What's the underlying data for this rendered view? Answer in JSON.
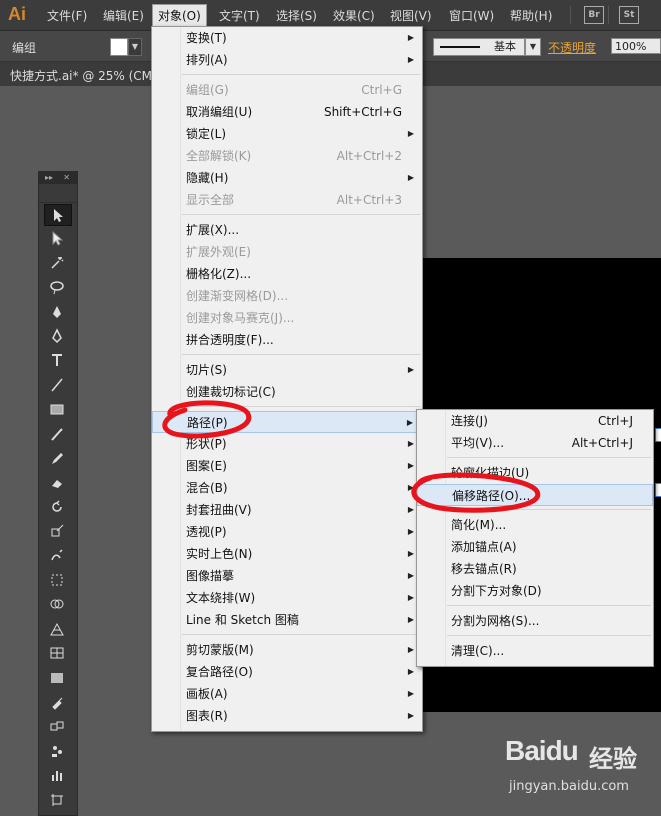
{
  "app": {
    "logo": "Ai"
  },
  "menubar": {
    "items": [
      "文件(F)",
      "编辑(E)",
      "对象(O)",
      "文字(T)",
      "选择(S)",
      "效果(C)",
      "视图(V)",
      "窗口(W)",
      "帮助(H)"
    ],
    "badges": [
      "Br",
      "St"
    ]
  },
  "control": {
    "label": "编组",
    "stroke_style": "基本",
    "opacity_label": "不透明度",
    "opacity_value": "100%"
  },
  "document": {
    "tab_label": "快捷方式.ai* @ 25% (CM"
  },
  "object_menu": [
    {
      "label": "变换(T)",
      "submenu": true
    },
    {
      "label": "排列(A)",
      "submenu": true
    },
    {
      "sep": true
    },
    {
      "label": "编组(G)",
      "shortcut": "Ctrl+G",
      "disabled": true
    },
    {
      "label": "取消编组(U)",
      "shortcut": "Shift+Ctrl+G"
    },
    {
      "label": "锁定(L)",
      "submenu": true
    },
    {
      "label": "全部解锁(K)",
      "shortcut": "Alt+Ctrl+2",
      "disabled": true
    },
    {
      "label": "隐藏(H)",
      "submenu": true
    },
    {
      "label": "显示全部",
      "shortcut": "Alt+Ctrl+3",
      "disabled": true
    },
    {
      "sep": true
    },
    {
      "label": "扩展(X)..."
    },
    {
      "label": "扩展外观(E)",
      "disabled": true
    },
    {
      "label": "栅格化(Z)..."
    },
    {
      "label": "创建渐变网格(D)...",
      "disabled": true
    },
    {
      "label": "创建对象马赛克(J)...",
      "disabled": true
    },
    {
      "label": "拼合透明度(F)..."
    },
    {
      "sep": true
    },
    {
      "label": "切片(S)",
      "submenu": true
    },
    {
      "label": "创建裁切标记(C)"
    },
    {
      "sep": true
    },
    {
      "label": "路径(P)",
      "submenu": true,
      "highlighted": true
    },
    {
      "label": "形状(P)",
      "submenu": true
    },
    {
      "label": "图案(E)",
      "submenu": true
    },
    {
      "label": "混合(B)",
      "submenu": true
    },
    {
      "label": "封套扭曲(V)",
      "submenu": true
    },
    {
      "label": "透视(P)",
      "submenu": true
    },
    {
      "label": "实时上色(N)",
      "submenu": true
    },
    {
      "label": "图像描摹",
      "submenu": true
    },
    {
      "label": "文本绕排(W)",
      "submenu": true
    },
    {
      "label": "Line 和 Sketch 图稿",
      "submenu": true
    },
    {
      "sep": true
    },
    {
      "label": "剪切蒙版(M)",
      "submenu": true
    },
    {
      "label": "复合路径(O)",
      "submenu": true
    },
    {
      "label": "画板(A)",
      "submenu": true
    },
    {
      "label": "图表(R)",
      "submenu": true
    }
  ],
  "path_submenu": [
    {
      "label": "连接(J)",
      "shortcut": "Ctrl+J"
    },
    {
      "label": "平均(V)...",
      "shortcut": "Alt+Ctrl+J"
    },
    {
      "sep": true
    },
    {
      "label": "轮廓化描边(U)"
    },
    {
      "label": "偏移路径(O)...",
      "highlighted": true
    },
    {
      "sep": true
    },
    {
      "label": "简化(M)..."
    },
    {
      "label": "添加锚点(A)"
    },
    {
      "label": "移去锚点(R)"
    },
    {
      "label": "分割下方对象(D)"
    },
    {
      "sep": true
    },
    {
      "label": "分割为网格(S)..."
    },
    {
      "sep": true
    },
    {
      "label": "清理(C)..."
    }
  ],
  "watermark": {
    "brand": "Baidu",
    "cn": "经验",
    "url": "jingyan.baidu.com"
  },
  "tools": [
    "selection-tool-icon",
    "direct-selection-tool-icon",
    "magic-wand-tool-icon",
    "lasso-tool-icon",
    "pen-tool-icon",
    "curvature-tool-icon",
    "type-tool-icon",
    "line-segment-tool-icon",
    "rectangle-tool-icon",
    "paintbrush-tool-icon",
    "pencil-tool-icon",
    "eraser-tool-icon",
    "rotate-tool-icon",
    "scale-tool-icon",
    "warp-tool-icon",
    "free-transform-tool-icon",
    "shape-builder-tool-icon",
    "perspective-grid-tool-icon",
    "mesh-tool-icon",
    "gradient-tool-icon",
    "eyedropper-tool-icon",
    "blend-tool-icon",
    "symbol-sprayer-tool-icon",
    "column-graph-tool-icon",
    "artboard-tool-icon"
  ]
}
